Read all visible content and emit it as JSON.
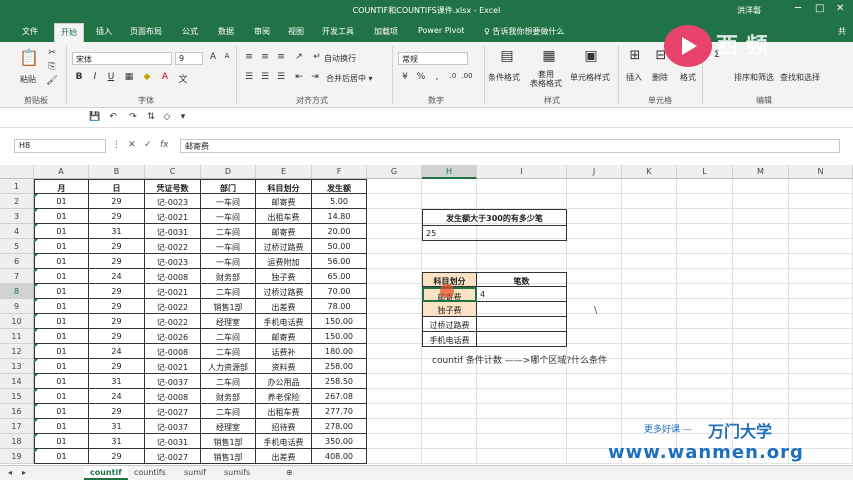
{
  "window": {
    "title": "COUNTIF和COUNTIFS课件.xlsx  -  Excel",
    "user": "洪洋磐",
    "minimize": "─",
    "restore": "□",
    "close": "✕"
  },
  "tabs": [
    "文件",
    "开始",
    "插入",
    "页面布局",
    "公式",
    "数据",
    "审阅",
    "视图",
    "开发工具",
    "加载项",
    "Power Pivot",
    "♀ 告诉我你想要做什么"
  ],
  "share": "共",
  "ribbon": {
    "paste": "粘贴",
    "font_name": "宋体",
    "font_size": "9",
    "wrap": "自动换行",
    "merge": "合并后居中 ▾",
    "number_format": "常规",
    "cond_format": "条件格式",
    "table_format": "套用\n表格格式",
    "cell_style": "单元格样式",
    "insert": "插入",
    "delete": "删除",
    "format": "格式",
    "sort": "排序和筛选",
    "find": "查找和选择",
    "groups": [
      "剪贴板",
      "字体",
      "对齐方式",
      "数字",
      "样式",
      "单元格",
      "编辑"
    ]
  },
  "formula_bar": {
    "cell": "H8",
    "fx": "fx",
    "content": "邮寄费"
  },
  "columns": [
    "A",
    "B",
    "C",
    "D",
    "E",
    "F",
    "G",
    "H",
    "I",
    "J",
    "K",
    "L",
    "M",
    "N"
  ],
  "rows": [
    [
      "月",
      "日",
      "凭证号数",
      "部门",
      "科目划分",
      "发生额"
    ],
    [
      "01",
      "29",
      "记-0023",
      "一车间",
      "邮寄费",
      "5.00"
    ],
    [
      "01",
      "29",
      "记-0021",
      "一车间",
      "出租车费",
      "14.80"
    ],
    [
      "01",
      "31",
      "记-0031",
      "二车间",
      "邮寄费",
      "20.00"
    ],
    [
      "01",
      "29",
      "记-0022",
      "一车间",
      "过桥过路费",
      "50.00"
    ],
    [
      "01",
      "29",
      "记-0023",
      "一车间",
      "运费附加",
      "56.00"
    ],
    [
      "01",
      "24",
      "记-0008",
      "财务部",
      "独子费",
      "65.00"
    ],
    [
      "01",
      "29",
      "记-0021",
      "二车间",
      "过桥过路费",
      "70.00"
    ],
    [
      "01",
      "29",
      "记-0022",
      "销售1部",
      "出差费",
      "78.00"
    ],
    [
      "01",
      "29",
      "记-0022",
      "经理室",
      "手机电话费",
      "150.00"
    ],
    [
      "01",
      "29",
      "记-0026",
      "二车间",
      "邮寄费",
      "150.00"
    ],
    [
      "01",
      "24",
      "记-0008",
      "二车间",
      "话费补",
      "180.00"
    ],
    [
      "01",
      "29",
      "记-0021",
      "人力资源部",
      "资料费",
      "258.00"
    ],
    [
      "01",
      "31",
      "记-0037",
      "二车间",
      "办公用品",
      "258.50"
    ],
    [
      "01",
      "24",
      "记-0008",
      "财务部",
      "养老保险",
      "267.08"
    ],
    [
      "01",
      "29",
      "记-0027",
      "二车间",
      "出租车费",
      "277.70"
    ],
    [
      "01",
      "31",
      "记-0037",
      "经理室",
      "招待费",
      "278.00"
    ],
    [
      "01",
      "31",
      "记-0031",
      "销售1部",
      "手机电话费",
      "350.00"
    ],
    [
      "01",
      "29",
      "记-0027",
      "销售1部",
      "出差费",
      "408.00"
    ]
  ],
  "side": {
    "q_title": "发生额大于300的有多少笔",
    "q_value": "25",
    "t_header1": "科目划分",
    "t_header2": "笔数",
    "t_rows": [
      [
        "邮寄费",
        "4"
      ],
      [
        "独子费",
        ""
      ],
      [
        "过桥过路费",
        ""
      ],
      [
        "手机电话费",
        ""
      ]
    ],
    "note": "countif  条件计数   ——>哪个区域?什么条件",
    "backslash": "\\"
  },
  "sheets": [
    "countif",
    "countifs",
    "sumif",
    "sumifs",
    "⊕"
  ],
  "watermark": {
    "line1": "更多好课 —",
    "brand": "万门大学",
    "url": "www.wanmen.org",
    "logo_text": "西  频"
  }
}
